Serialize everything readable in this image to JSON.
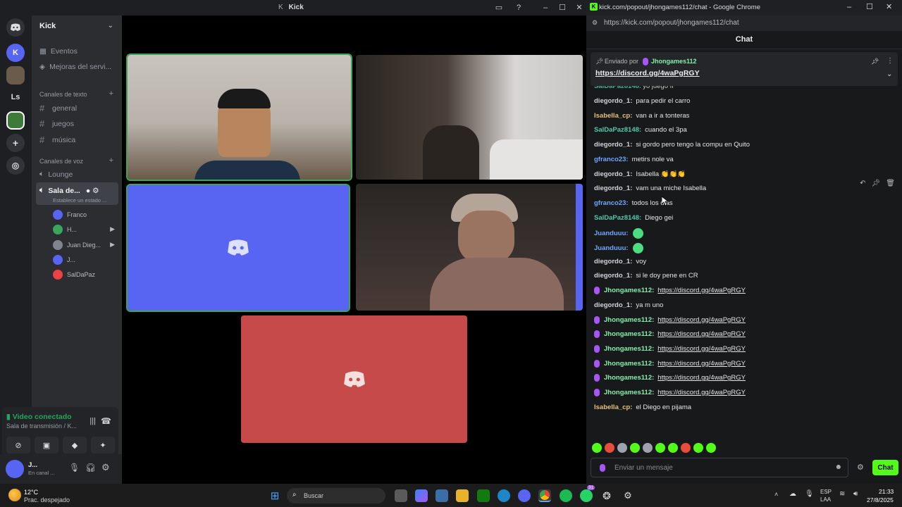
{
  "window": {
    "title": "Kick",
    "title_glyph": "K"
  },
  "server": {
    "name": "Kick"
  },
  "rail": {
    "servers": [
      "K",
      "Ls"
    ]
  },
  "sidebar": {
    "events": "Eventos",
    "boosts": "Mejoras del servi...",
    "text_category": "Canales de texto",
    "text_channels": [
      "general",
      "juegos",
      "música"
    ],
    "voice_category": "Canales de voz",
    "voice_channels": [
      {
        "name": "Lounge"
      },
      {
        "name": "Sala de...",
        "status": "Establece un estado ..."
      }
    ],
    "voice_users": [
      {
        "name": "Franco",
        "color": "#5865f2"
      },
      {
        "name": "H...",
        "color": "#3ba55c",
        "camera": true
      },
      {
        "name": "Juan Dieg...",
        "color": "#80848e",
        "camera": true
      },
      {
        "name": "J...",
        "color": "#5865f2"
      },
      {
        "name": "SalDaPaz",
        "color": "#ed4245"
      }
    ]
  },
  "voice_panel": {
    "status": "Video conectado",
    "location": "Sala de transmisión / K...",
    "user_name": "J...",
    "user_status": "En canal ..."
  },
  "video_tiles": [
    {
      "id": "cam-1"
    },
    {
      "id": "cam-2"
    },
    {
      "id": "avatar-blue",
      "color": "#5865f2"
    },
    {
      "id": "cam-4"
    },
    {
      "id": "avatar-red",
      "color": "#c74a4a"
    }
  ],
  "chrome": {
    "tab_title": "kick.com/popout/jhongames112/chat - Google Chrome",
    "url": "https://kick.com/popout/jhongames112/chat",
    "chat_heading": "Chat",
    "pinned": {
      "label": "Enviado por",
      "author": "Jhongames112",
      "link": "https://discord.gg/4waPgRGY"
    },
    "input_placeholder": "Enviar un mensaje",
    "send_label": "Chat"
  },
  "chat": {
    "partial_top": {
      "user": "SalDaPaz8148:",
      "text": "yo juego ff"
    },
    "messages": [
      {
        "user": "diegordo_1:",
        "text": "para pedir el carro",
        "color": "#d1d5db"
      },
      {
        "user": "Isabella_cp:",
        "text": "van a ir a tonteras",
        "color": "#e5c07b"
      },
      {
        "user": "SalDaPaz8148:",
        "text": "cuando el 3pa",
        "color": "#4ec9b0"
      },
      {
        "user": "diegordo_1:",
        "text": "si gordo pero tengo la compu en Quito",
        "color": "#d1d5db"
      },
      {
        "user": "gfranco23:",
        "text": "metirs nole va",
        "color": "#6ea8fe"
      },
      {
        "user": "diegordo_1:",
        "text": "Isabella 👏👏👏",
        "color": "#d1d5db"
      },
      {
        "user": "diegordo_1:",
        "text": "vam una miche Isabella",
        "color": "#d1d5db"
      },
      {
        "user": "gfranco23:",
        "text": "todos los dias",
        "color": "#6ea8fe"
      },
      {
        "user": "SalDaPaz8148:",
        "text": "Diego gei",
        "color": "#4ec9b0"
      },
      {
        "user": "Juanduuu:",
        "text": "",
        "emote": true,
        "color": "#6ea8fe"
      },
      {
        "user": "Juanduuu:",
        "text": "",
        "emote": true,
        "color": "#6ea8fe"
      },
      {
        "user": "diegordo_1:",
        "text": "voy",
        "color": "#d1d5db"
      },
      {
        "user": "diegordo_1:",
        "text": "si le doy pene en CR",
        "color": "#d1d5db"
      },
      {
        "user": "Jhongames112:",
        "text": "https://discord.gg/4waPgRGY",
        "link": true,
        "mic": true,
        "color": "#86efac"
      },
      {
        "user": "diegordo_1:",
        "text": "ya m uno",
        "color": "#d1d5db"
      },
      {
        "user": "Jhongames112:",
        "text": "https://discord.gg/4waPgRGY",
        "link": true,
        "mic": true,
        "color": "#86efac"
      },
      {
        "user": "Jhongames112:",
        "text": "https://discord.gg/4waPgRGY",
        "link": true,
        "mic": true,
        "color": "#86efac"
      },
      {
        "user": "Jhongames112:",
        "text": "https://discord.gg/4waPgRGY",
        "link": true,
        "mic": true,
        "color": "#86efac"
      },
      {
        "user": "Jhongames112:",
        "text": "https://discord.gg/4waPgRGY",
        "link": true,
        "mic": true,
        "color": "#86efac"
      },
      {
        "user": "Jhongames112:",
        "text": "https://discord.gg/4waPgRGY",
        "link": true,
        "mic": true,
        "color": "#86efac"
      },
      {
        "user": "Jhongames112:",
        "text": "https://discord.gg/4waPgRGY",
        "link": true,
        "mic": true,
        "color": "#86efac"
      },
      {
        "user": "Isabella_cp:",
        "text": "el Diego en pijama",
        "color": "#e5c07b"
      }
    ]
  },
  "taskbar": {
    "weather_temp": "12°C",
    "weather_desc": "Prac. despejado",
    "search_label": "Buscar",
    "lang": "ESP",
    "lang_sub": "LAA",
    "time": "21:33",
    "date": "27/8/2025",
    "badge_count": "31"
  }
}
